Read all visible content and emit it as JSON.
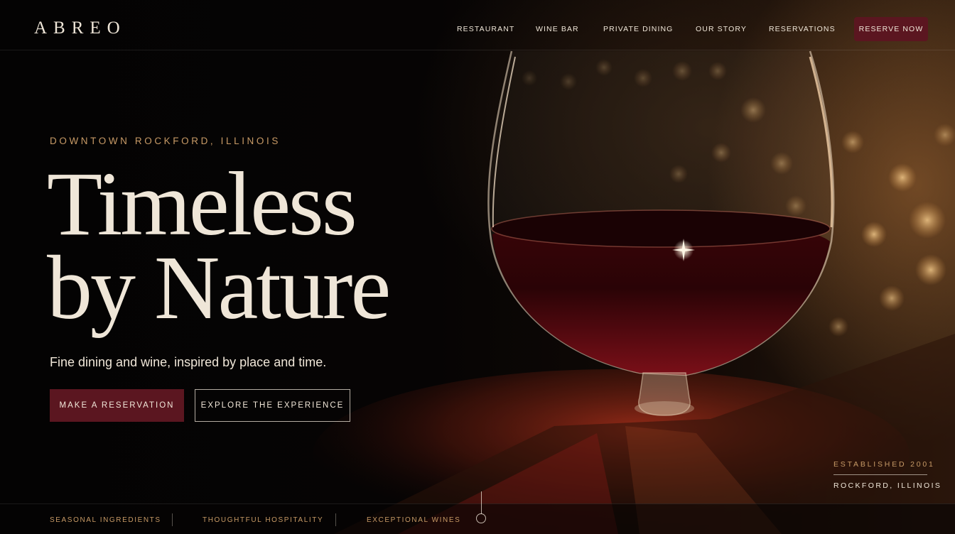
{
  "brand": {
    "logo": "ABREO"
  },
  "nav": {
    "items": [
      {
        "label": "RESTAURANT"
      },
      {
        "label": "WINE BAR"
      },
      {
        "label": "PRIVATE DINING"
      },
      {
        "label": "OUR STORY"
      },
      {
        "label": "RESERVATIONS"
      }
    ],
    "cta": "RESERVE NOW"
  },
  "hero": {
    "eyebrow": "DOWNTOWN ROCKFORD, ILLINOIS",
    "headline_line1": "Timeless",
    "headline_line2": "by Nature",
    "subhead": "Fine dining and wine, inspired by place and time.",
    "primary_cta": "MAKE A RESERVATION",
    "secondary_cta": "EXPLORE THE EXPERIENCE"
  },
  "established": {
    "label": "ESTABLISHED 2001",
    "location": "ROCKFORD, ILLINOIS"
  },
  "features": [
    {
      "label": "SEASONAL INGREDIENTS"
    },
    {
      "label": "THOUGHTFUL HOSPITALITY"
    },
    {
      "label": "EXCEPTIONAL WINES"
    }
  ],
  "colors": {
    "background": "#050404",
    "accent_burgundy": "#5b1620",
    "accent_gold": "#c79a66",
    "text_cream": "#efe6d8",
    "wine_red": "#7a0f18"
  },
  "hero_image": {
    "icon": "wine-glass-illustration"
  }
}
